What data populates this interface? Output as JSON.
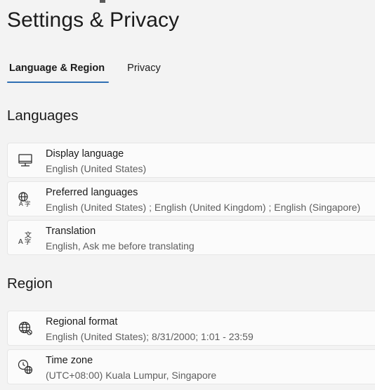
{
  "header": {
    "title": "Settings & Privacy"
  },
  "tabs": [
    {
      "label": "Language & Region",
      "active": true
    },
    {
      "label": "Privacy",
      "active": false
    }
  ],
  "languages": {
    "heading": "Languages",
    "items": [
      {
        "title": "Display language",
        "value": "English (United States)",
        "icon": "monitor-icon"
      },
      {
        "title": "Preferred languages",
        "value": "English (United States) ; English (United Kingdom) ; English (Singapore)",
        "icon": "language-globe-icon"
      },
      {
        "title": "Translation",
        "value": "English, Ask me before translating",
        "icon": "translate-icon"
      }
    ]
  },
  "region": {
    "heading": "Region",
    "items": [
      {
        "title": "Regional format",
        "value": "English (United States); 8/31/2000; 1:01 - 23:59",
        "icon": "globe-format-icon"
      },
      {
        "title": "Time zone",
        "value": "(UTC+08:00) Kuala Lumpur, Singapore",
        "icon": "clock-globe-icon"
      }
    ]
  },
  "colors": {
    "accent": "#2f6fb3",
    "background": "#f3f3f3",
    "card": "#fbfbfb"
  }
}
